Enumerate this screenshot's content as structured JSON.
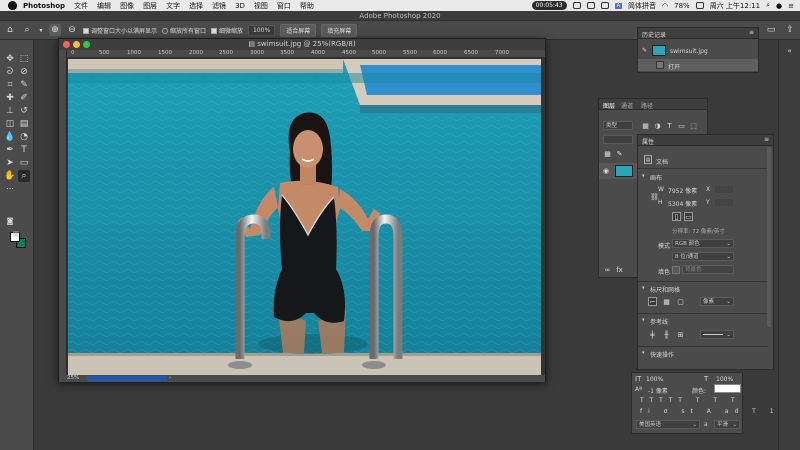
{
  "menubar": {
    "app": "Photoshop",
    "items": [
      "文件",
      "编辑",
      "图像",
      "图层",
      "文字",
      "选择",
      "滤镜",
      "3D",
      "视图",
      "窗口",
      "帮助"
    ],
    "recording": "00:05:43",
    "ime": "简体拼音",
    "battery": "78%",
    "clock": "周六 上午12:11"
  },
  "window": {
    "title": "Adobe Photoshop 2020"
  },
  "options": {
    "resize_label": "调整窗口大小以满屏显示",
    "zoom_all_label": "缩放所有窗口",
    "scrubby_label": "细微缩放",
    "zoom_value": "100%",
    "fit_label": "适合屏幕",
    "fill_label": "填充屏幕"
  },
  "document": {
    "title": "swimsuit.jpg @ 25%(RGB/8)",
    "zoom": "25%",
    "ruler_ticks": [
      "0",
      "500",
      "1000",
      "1500",
      "2000",
      "2500",
      "3000",
      "3500",
      "4000",
      "4500",
      "5000",
      "5500",
      "6000",
      "6500",
      "7000"
    ]
  },
  "history": {
    "title": "历史记录",
    "snapshot": "swimsuit.jpg",
    "step": "打开"
  },
  "layers": {
    "tabs": [
      "图层",
      "通道",
      "路径"
    ],
    "kind": "类型"
  },
  "properties": {
    "title": "属性",
    "doc_label": "文档",
    "canvas_section": "画布",
    "w_label": "W",
    "w_value": "7952 像素",
    "h_label": "H",
    "h_value": "5304 像素",
    "x_label": "X",
    "y_label": "Y",
    "resolution": "分辨率: 72 像素/英寸",
    "mode_label": "模式",
    "mode_value": "RGB 颜色",
    "bit_value": "8 位/通道",
    "fill_label": "填色",
    "fill_value": "背景色",
    "rulers_section": "标尺和网格",
    "rulers_unit": "像素",
    "guides_section": "参考线",
    "quick_section": "快速操作"
  },
  "character": {
    "scale_v": "100%",
    "scale_h": "100%",
    "baseline": "-1 像素",
    "color_label": "颜色:",
    "lang": "美国英语",
    "aa_label": "a",
    "aa_value": "平滑"
  },
  "colors": {
    "accent": "#2255b0",
    "bg_swatch": "#137a5c"
  },
  "icons": [
    "move-tool-icon",
    "marquee-tool-icon",
    "lasso-tool-icon",
    "brush-tool-icon",
    "type-tool-icon",
    "hand-tool-icon",
    "zoom-tool-icon"
  ]
}
